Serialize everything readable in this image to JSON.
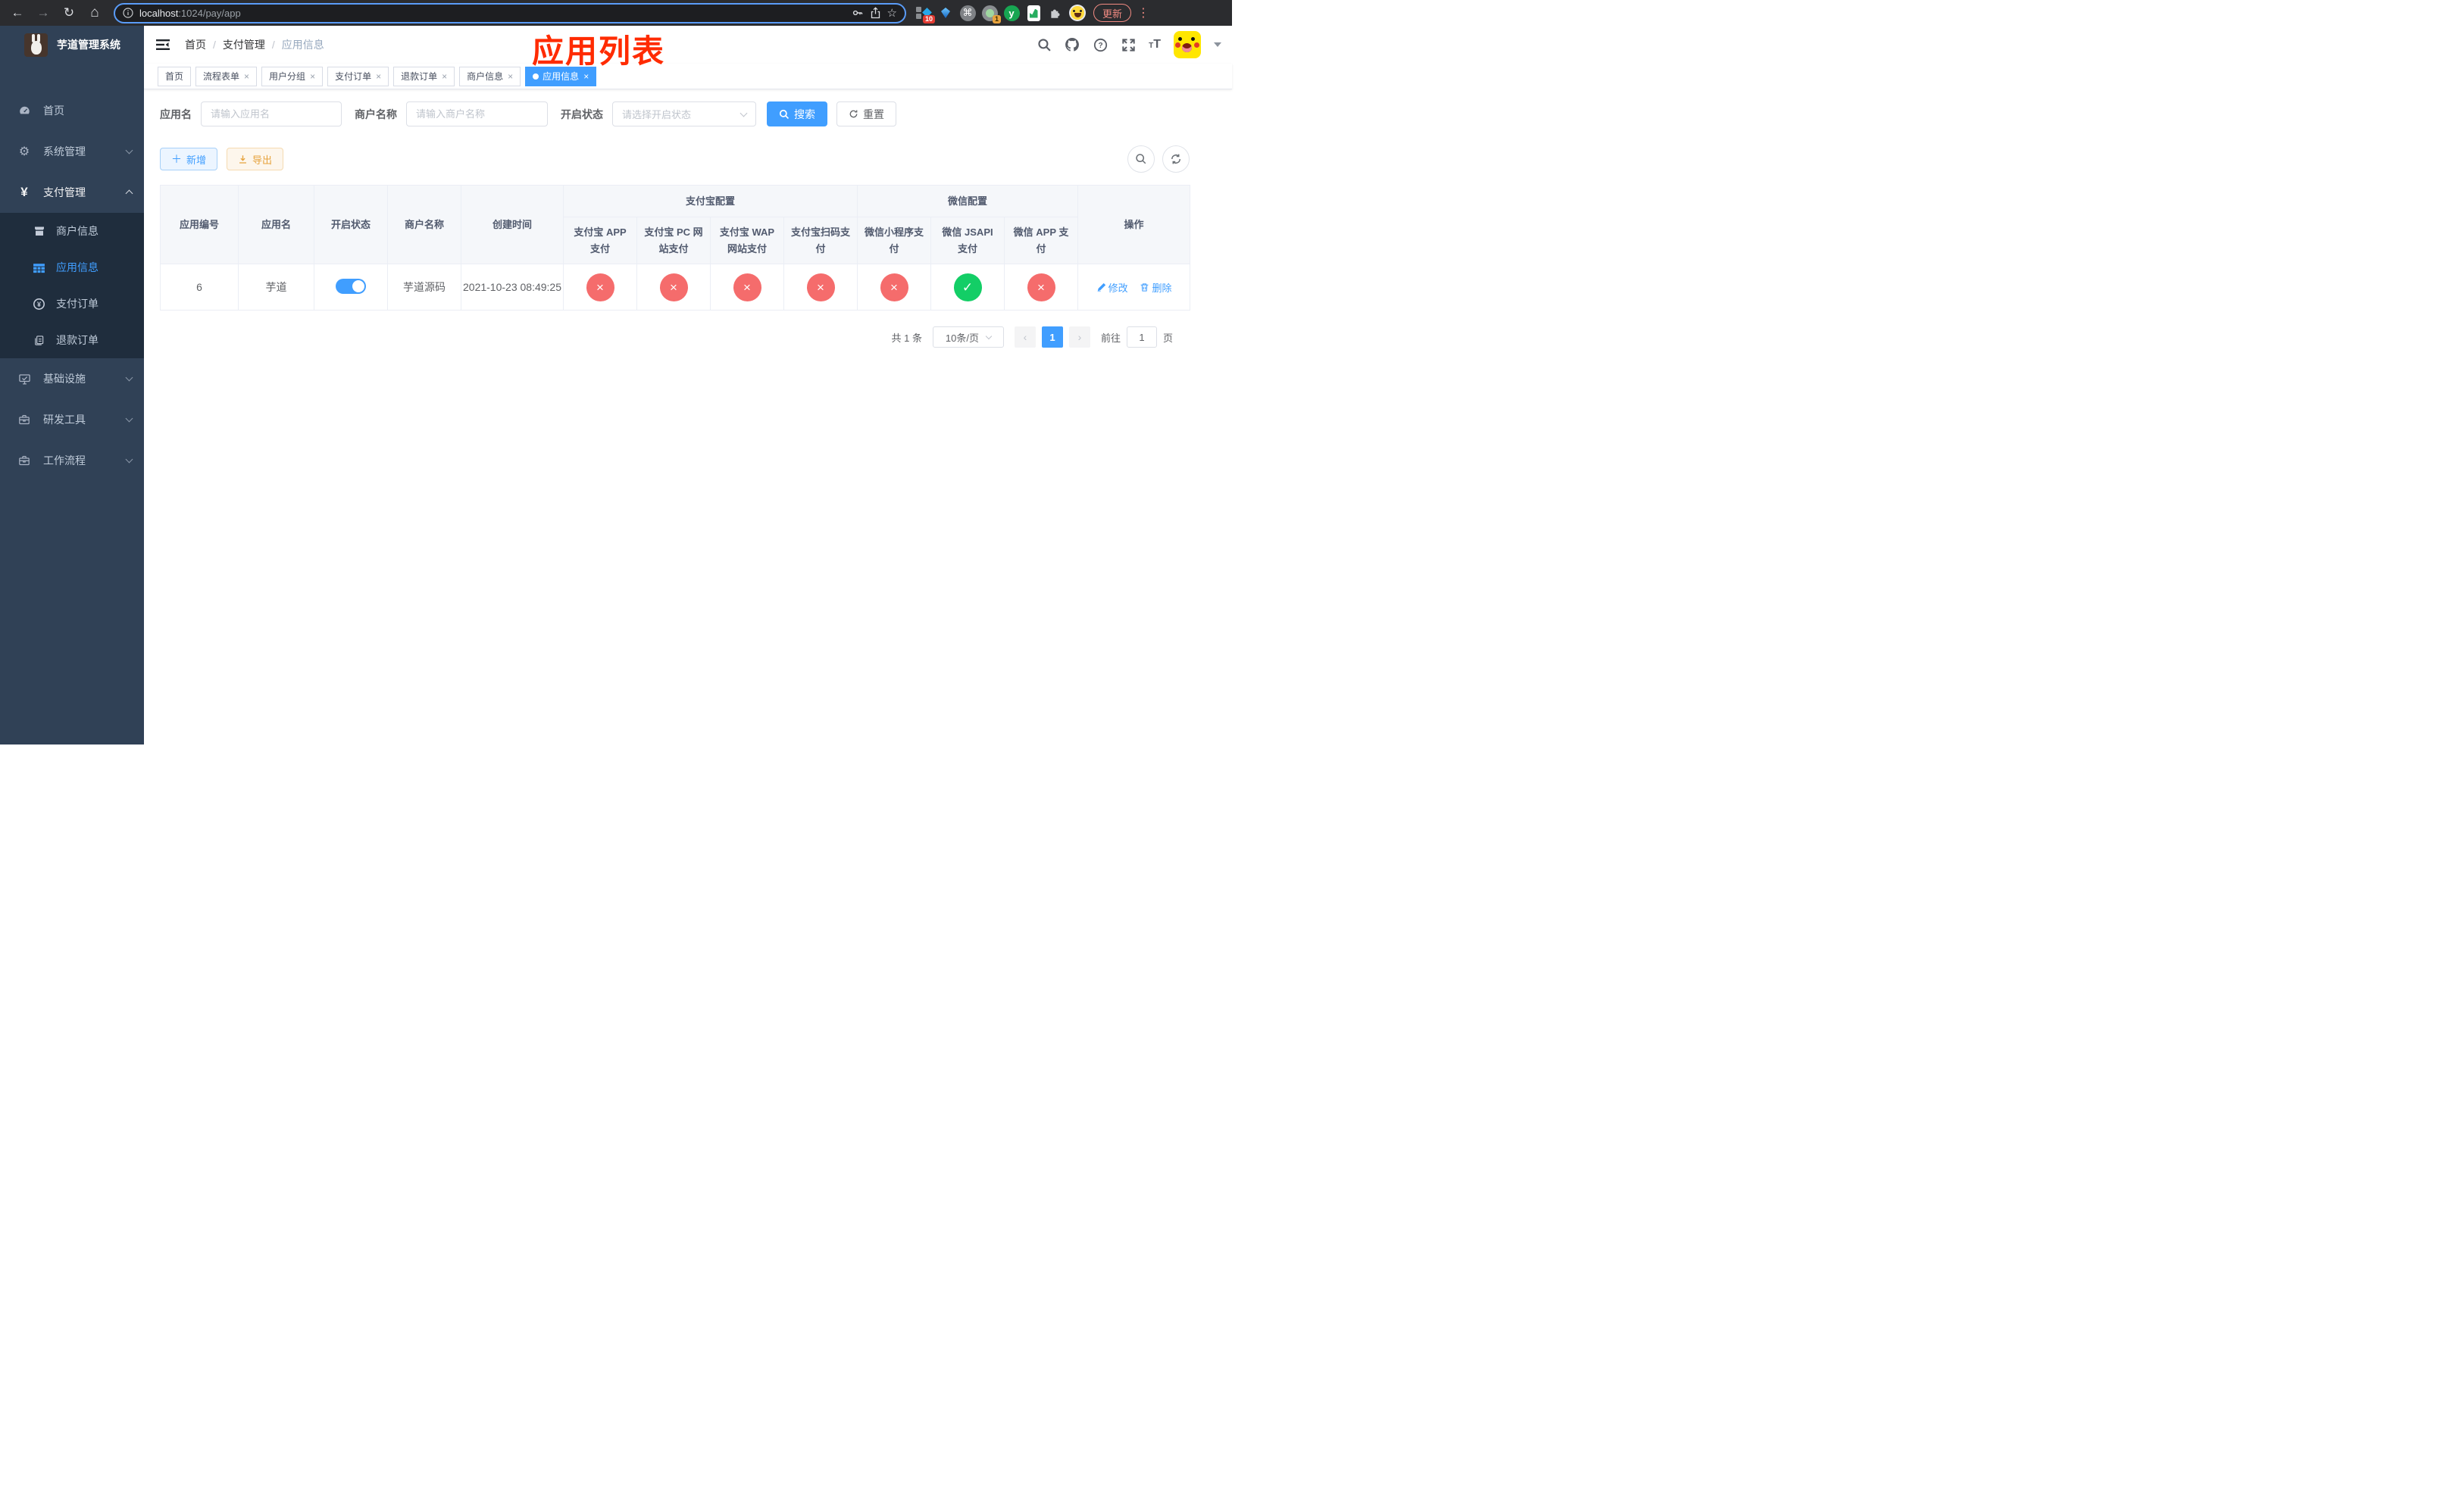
{
  "browser": {
    "url": {
      "host": "localhost",
      "path": ":1024/pay/app"
    },
    "update_label": "更新",
    "ext_badges": {
      "grid": "10",
      "tray": "1"
    },
    "ext_y_letter": "y"
  },
  "sidebar": {
    "title": "芋道管理系统",
    "menu": [
      {
        "label": "首页"
      },
      {
        "label": "系统管理"
      },
      {
        "label": "支付管理"
      },
      {
        "label": "基础设施"
      },
      {
        "label": "研发工具"
      },
      {
        "label": "工作流程"
      }
    ],
    "payment_submenu": [
      {
        "label": "商户信息"
      },
      {
        "label": "应用信息"
      },
      {
        "label": "支付订单"
      },
      {
        "label": "退款订单"
      }
    ]
  },
  "navbar": {
    "breadcrumb": [
      "首页",
      "支付管理",
      "应用信息"
    ]
  },
  "annotation": "应用列表",
  "tabs": [
    {
      "label": "首页",
      "closable": false,
      "active": false
    },
    {
      "label": "流程表单",
      "closable": true,
      "active": false
    },
    {
      "label": "用户分组",
      "closable": true,
      "active": false
    },
    {
      "label": "支付订单",
      "closable": true,
      "active": false
    },
    {
      "label": "退款订单",
      "closable": true,
      "active": false
    },
    {
      "label": "商户信息",
      "closable": true,
      "active": false
    },
    {
      "label": "应用信息",
      "closable": true,
      "active": true
    }
  ],
  "filters": {
    "app_name_label": "应用名",
    "app_name_placeholder": "请输入应用名",
    "merchant_label": "商户名称",
    "merchant_placeholder": "请输入商户名称",
    "status_label": "开启状态",
    "status_placeholder": "请选择开启状态",
    "search_label": "搜索",
    "reset_label": "重置"
  },
  "toolbar": {
    "add_label": "新增",
    "export_label": "导出"
  },
  "table": {
    "groups": {
      "alipay": "支付宝配置",
      "wechat": "微信配置"
    },
    "columns": [
      "应用编号",
      "应用名",
      "开启状态",
      "商户名称",
      "创建时间",
      "支付宝 APP 支付",
      "支付宝 PC 网站支付",
      "支付宝 WAP 网站支付",
      "支付宝扫码支付",
      "微信小程序支付",
      "微信 JSAPI 支付",
      "微信 APP 支付",
      "操作"
    ],
    "row": {
      "id": "6",
      "name": "芋道",
      "enabled": true,
      "merchant": "芋道源码",
      "created_at": "2021-10-23 08:49:25",
      "channel_status": [
        "off",
        "off",
        "off",
        "off",
        "off",
        "on",
        "off"
      ],
      "edit_label": "修改",
      "delete_label": "删除"
    }
  },
  "pagination": {
    "total_text": "共 1 条",
    "page_size": "10条/页",
    "current_page": "1",
    "goto_prefix": "前往",
    "goto_value": "1",
    "goto_suffix": "页"
  },
  "colors": {
    "accent": "#409eff",
    "danger": "#f56c6c",
    "success": "#13ce66",
    "sidebar": "#304156",
    "annotation": "#ff2b00"
  }
}
